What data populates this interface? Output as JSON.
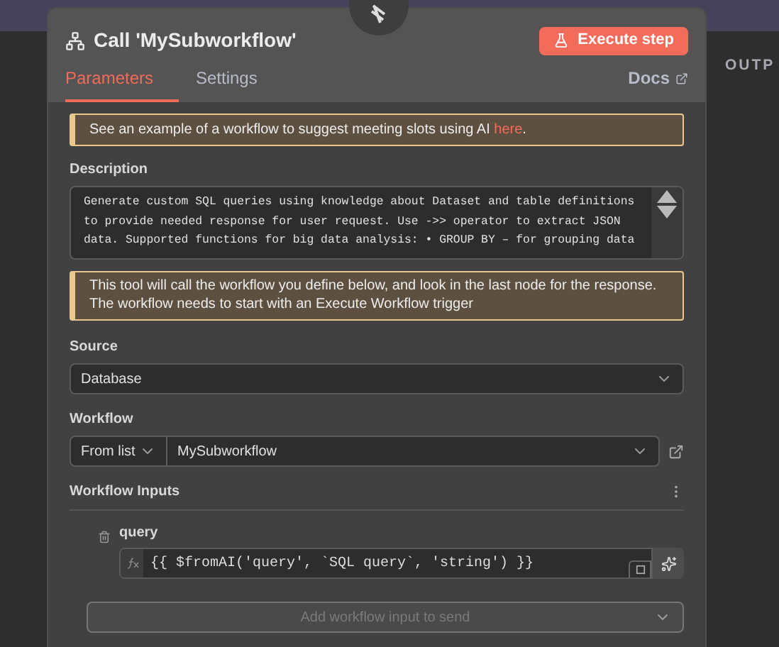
{
  "node": {
    "title": "Call 'MySubworkflow'",
    "execute_button": "Execute step"
  },
  "tabs": [
    {
      "label": "Parameters",
      "selected": true
    },
    {
      "label": "Settings",
      "selected": false
    }
  ],
  "docs_link": "Docs",
  "output_heading": "OUTP",
  "example_banner": "See an example of a workflow to suggest meeting slots using AI **here**.",
  "description": {
    "label": "Description",
    "value": "Generate custom SQL queries using knowledge about Dataset and table definitions to provide needed response for user request. Use ->> operator to extract JSON data. Supported functions for big data analysis: • GROUP BY – for grouping data"
  },
  "info_banner": "This tool will call the workflow you define below, and look in the last node for the response. The workflow needs to start with an Execute Workflow trigger",
  "source": {
    "label": "Source",
    "value": "Database"
  },
  "workflow": {
    "label": "Workflow",
    "mode": "From list",
    "value": "MySubworkflow"
  },
  "workflow_inputs": {
    "label": "Workflow Inputs",
    "inputs": [
      {
        "name": "query",
        "value": "{{ $fromAI('query', `SQL query`, 'string') }}"
      }
    ],
    "add_button": {
      "label": "Add workflow input to send",
      "disabled": true
    }
  }
}
